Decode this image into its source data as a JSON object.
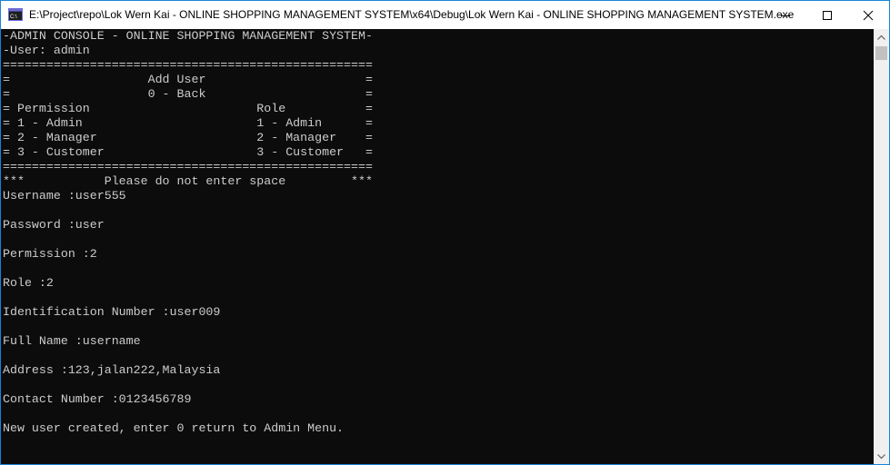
{
  "window": {
    "title": "E:\\Project\\repo\\Lok Wern Kai - ONLINE SHOPPING MANAGEMENT SYSTEM\\x64\\Debug\\Lok Wern Kai - ONLINE SHOPPING MANAGEMENT SYSTEM.exe",
    "app_icon": "console-app-icon",
    "app_icon_text": "C:\\",
    "controls": [
      "minimize-icon",
      "maximize-icon",
      "close-icon"
    ]
  },
  "console": {
    "lines": [
      "-ADMIN CONSOLE - ONLINE SHOPPING MANAGEMENT SYSTEM-",
      "-User: admin",
      "===================================================",
      "=                   Add User                      =",
      "=                   0 - Back                      =",
      "= Permission                       Role           =",
      "= 1 - Admin                        1 - Admin      =",
      "= 2 - Manager                      2 - Manager    =",
      "= 3 - Customer                     3 - Customer   =",
      "===================================================",
      "***           Please do not enter space         ***",
      "Username :user555",
      "",
      "Password :user",
      "",
      "Permission :2",
      "",
      "Role :2",
      "",
      "Identification Number :user009",
      "",
      "Full Name :username",
      "",
      "Address :123,jalan222,Malaysia",
      "",
      "Contact Number :0123456789",
      "",
      "New user created, enter 0 return to Admin Menu."
    ]
  },
  "colors": {
    "console_bg": "#0c0c0c",
    "console_fg": "#cccccc",
    "window_border": "#1883d7"
  }
}
